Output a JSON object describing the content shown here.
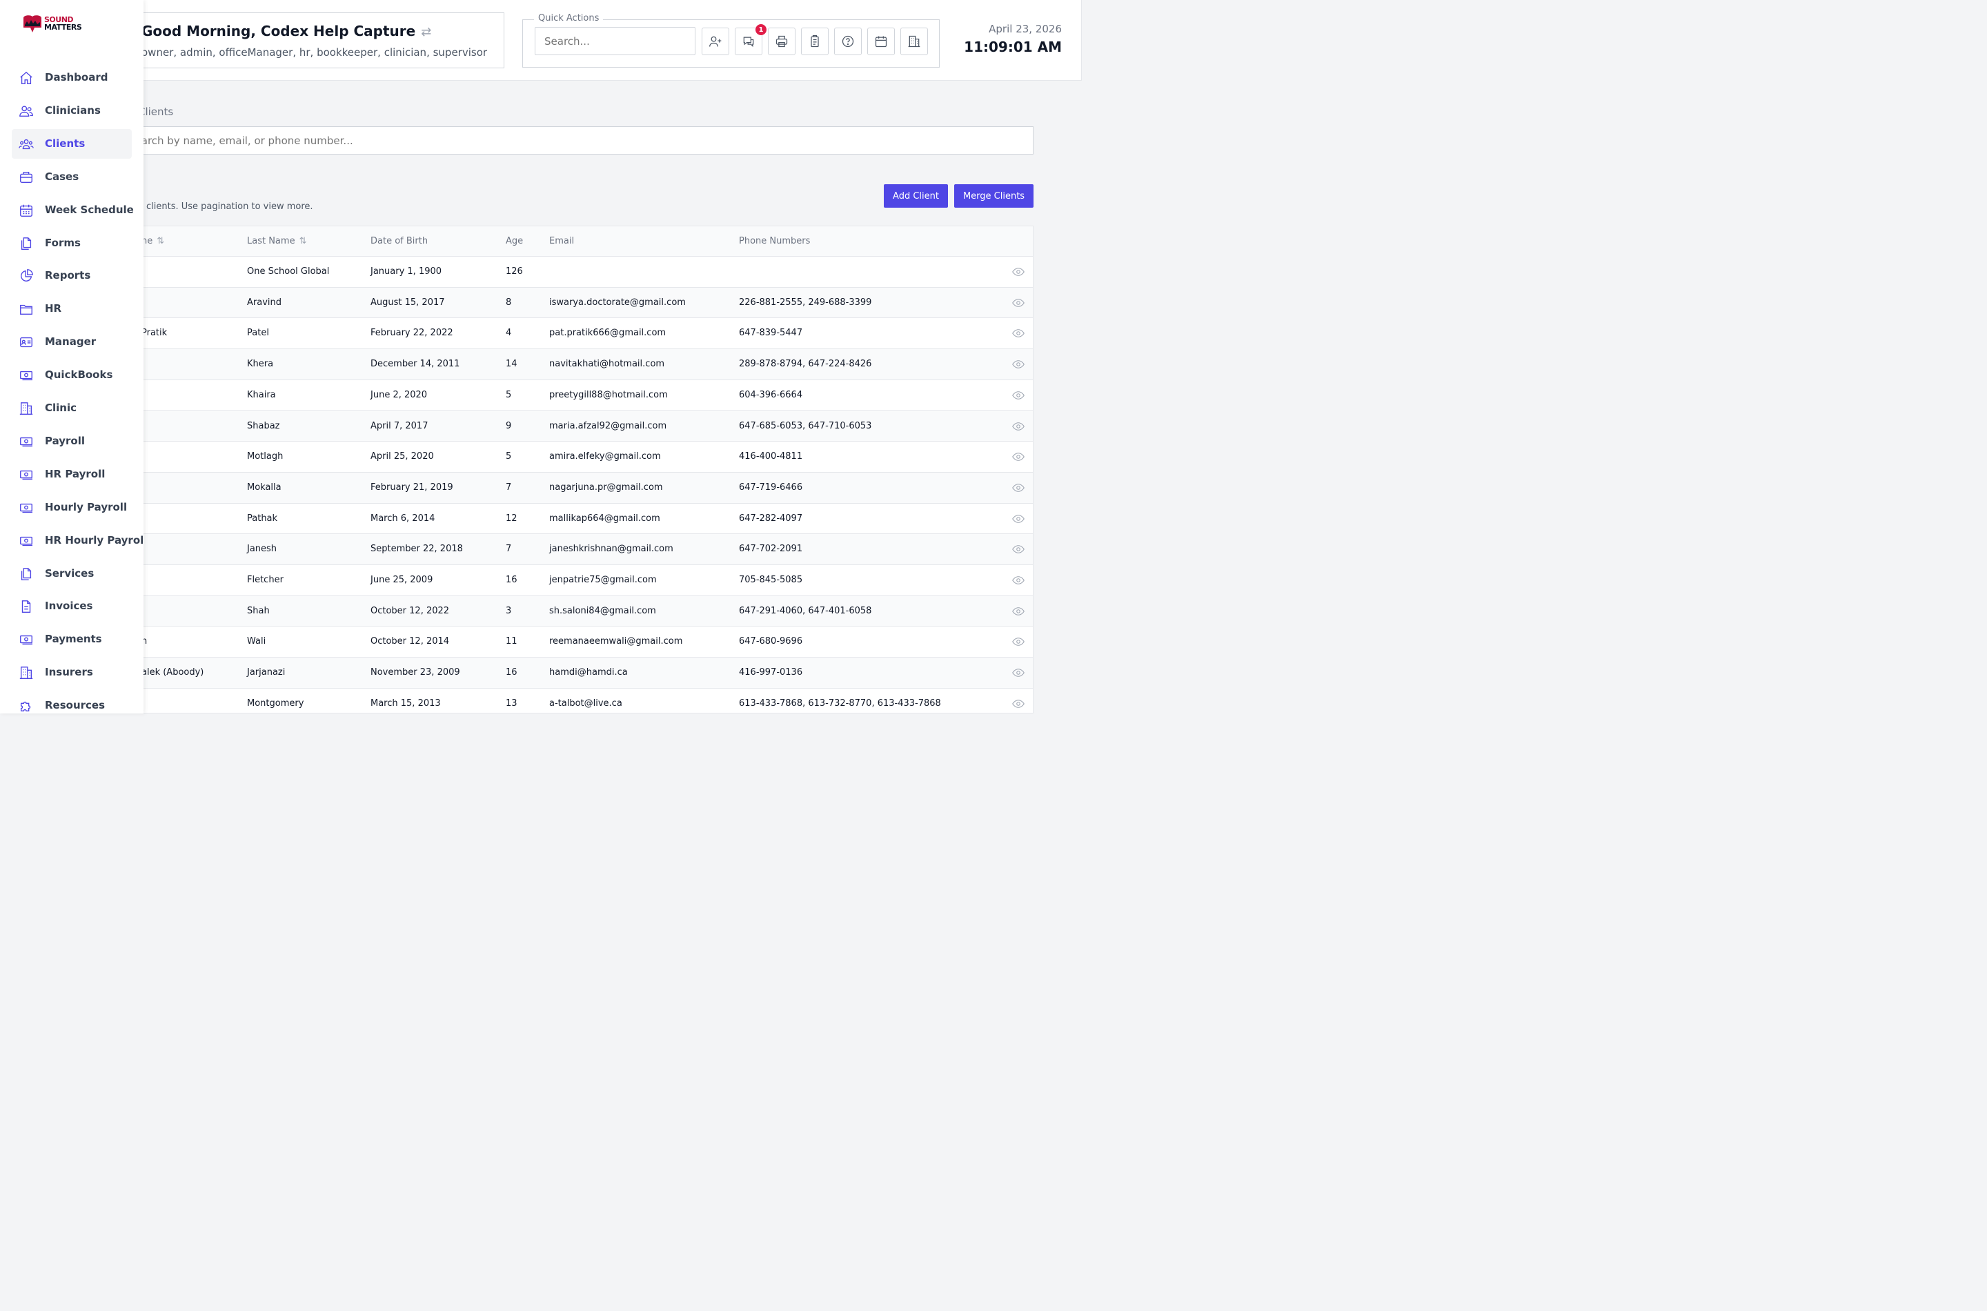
{
  "header": {
    "greeting": "Good Morning, Codex Help Capture",
    "roles": "owner, admin, officeManager, hr, bookkeeper, clinician, supervisor",
    "quick_actions_label": "Quick Actions",
    "search_placeholder": "Search...",
    "messages_badge": "1",
    "date": "April 23, 2026",
    "time": "11:09:01 AM"
  },
  "brand": {
    "line1": "SOUND",
    "line2": "MATTERS"
  },
  "sidebar": {
    "items": [
      {
        "label": "Dashboard",
        "icon": "home-icon"
      },
      {
        "label": "Clinicians",
        "icon": "users-icon"
      },
      {
        "label": "Clients",
        "icon": "user-group-icon",
        "active": true
      },
      {
        "label": "Cases",
        "icon": "briefcase-icon"
      },
      {
        "label": "Week Schedule",
        "icon": "calendar-icon"
      },
      {
        "label": "Forms",
        "icon": "documents-icon"
      },
      {
        "label": "Reports",
        "icon": "pie-chart-icon"
      },
      {
        "label": "HR",
        "icon": "folder-icon"
      },
      {
        "label": "Manager",
        "icon": "id-card-icon"
      },
      {
        "label": "QuickBooks",
        "icon": "money-icon"
      },
      {
        "label": "Clinic",
        "icon": "building-icon"
      },
      {
        "label": "Payroll",
        "icon": "money-icon"
      },
      {
        "label": "HR Payroll",
        "icon": "money-icon"
      },
      {
        "label": "Hourly Payroll",
        "icon": "money-icon"
      },
      {
        "label": "HR Hourly Payroll",
        "icon": "money-icon"
      },
      {
        "label": "Services",
        "icon": "documents-icon"
      },
      {
        "label": "Invoices",
        "icon": "document-text-icon"
      },
      {
        "label": "Payments",
        "icon": "money-icon"
      },
      {
        "label": "Insurers",
        "icon": "building-icon"
      },
      {
        "label": "Resources",
        "icon": "puzzle-icon"
      }
    ]
  },
  "page": {
    "section_label": "Clients",
    "search_placeholder": "Search by name, email, or phone number...",
    "pagination_note": "clients. Use pagination to view more.",
    "add_client": "Add Client",
    "merge_clients": "Merge Clients"
  },
  "table": {
    "columns": [
      "ne",
      "Last Name",
      "Date of Birth",
      "Age",
      "Email",
      "Phone Numbers"
    ],
    "rows": [
      {
        "first": "",
        "last": "One School Global",
        "dob": "January 1, 1900",
        "age": "126",
        "email": "",
        "phones": ""
      },
      {
        "first": "",
        "last": "Aravind",
        "dob": "August 15, 2017",
        "age": "8",
        "email": "iswarya.doctorate@gmail.com",
        "phones": "226-881-2555, 249-688-3399"
      },
      {
        "first": "Pratik",
        "last": "Patel",
        "dob": "February 22, 2022",
        "age": "4",
        "email": "pat.pratik666@gmail.com",
        "phones": "647-839-5447"
      },
      {
        "first": "",
        "last": "Khera",
        "dob": "December 14, 2011",
        "age": "14",
        "email": "navitakhati@hotmail.com",
        "phones": "289-878-8794, 647-224-8426"
      },
      {
        "first": "",
        "last": "Khaira",
        "dob": "June 2, 2020",
        "age": "5",
        "email": "preetygill88@hotmail.com",
        "phones": "604-396-6664"
      },
      {
        "first": "",
        "last": "Shabaz",
        "dob": "April 7, 2017",
        "age": "9",
        "email": "maria.afzal92@gmail.com",
        "phones": "647-685-6053, 647-710-6053"
      },
      {
        "first": "",
        "last": "Motlagh",
        "dob": "April 25, 2020",
        "age": "5",
        "email": "amira.elfeky@gmail.com",
        "phones": "416-400-4811"
      },
      {
        "first": "",
        "last": "Mokalla",
        "dob": "February 21, 2019",
        "age": "7",
        "email": "nagarjuna.pr@gmail.com",
        "phones": "647-719-6466"
      },
      {
        "first": "",
        "last": "Pathak",
        "dob": "March 6, 2014",
        "age": "12",
        "email": "mallikap664@gmail.com",
        "phones": "647-282-4097"
      },
      {
        "first": "",
        "last": "Janesh",
        "dob": "September 22, 2018",
        "age": "7",
        "email": "janeshkrishnan@gmail.com",
        "phones": "647-702-2091"
      },
      {
        "first": "",
        "last": "Fletcher",
        "dob": "June 25, 2009",
        "age": "16",
        "email": "jenpatrie75@gmail.com",
        "phones": "705-845-5085"
      },
      {
        "first": "",
        "last": "Shah",
        "dob": "October 12, 2022",
        "age": "3",
        "email": "sh.saloni84@gmail.com",
        "phones": "647-291-4060, 647-401-6058"
      },
      {
        "first": "n",
        "last": "Wali",
        "dob": "October 12, 2014",
        "age": "11",
        "email": "reemanaeemwali@gmail.com",
        "phones": "647-680-9696"
      },
      {
        "first": "alek (Aboody)",
        "last": "Jarjanazi",
        "dob": "November 23, 2009",
        "age": "16",
        "email": "hamdi@hamdi.ca",
        "phones": "416-997-0136"
      },
      {
        "first": "",
        "last": "Montgomery",
        "dob": "March 15, 2013",
        "age": "13",
        "email": "a-talbot@live.ca",
        "phones": "613-433-7868, 613-732-8770, 613-433-7868"
      }
    ]
  },
  "colors": {
    "accent": "#4f46e5",
    "badge": "#e11d48",
    "brand": "#be123c"
  }
}
